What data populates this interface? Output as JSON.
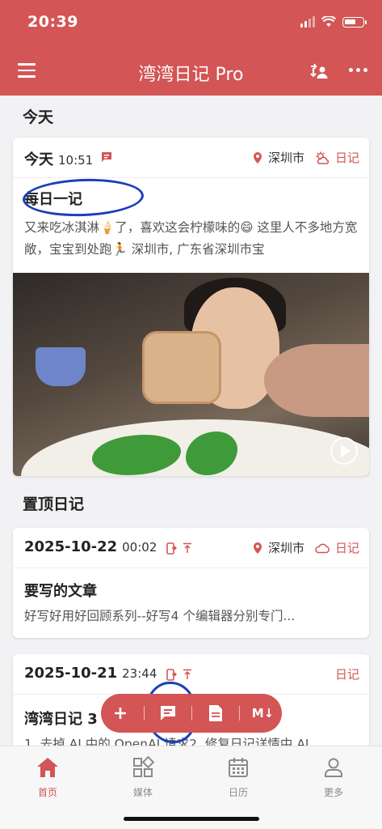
{
  "status": {
    "time": "20:39"
  },
  "app": {
    "title": "湾湾日记 Pro"
  },
  "sections": {
    "today": "今天",
    "pinned": "置顶日记"
  },
  "today_entry": {
    "date": "今天",
    "time": "10:51",
    "location": "深圳市",
    "tag": "日记",
    "title": "每日一记",
    "snippet": "又来吃冰淇淋🍦了，喜欢这会柠檬味的😄 这里人不多地方宽敞，宝宝到处跑🏃 深圳市, 广东省深圳市宝"
  },
  "pinned_entries": [
    {
      "date": "2025-10-22",
      "time": "00:02",
      "location": "深圳市",
      "tag": "日记",
      "title": "要写的文章",
      "snippet": "好写好用好回顾系列--好写4 个编辑器分别专门..."
    },
    {
      "date": "2025-10-21",
      "time": "23:44",
      "tag": "日记",
      "title": "湾湾日记 3",
      "snippet": "1. 去掉 AI 中的 OpenAI 请求2. 修复日记详情中 AI"
    }
  ],
  "fab": {
    "markdown_label": "M↓"
  },
  "tabs": [
    {
      "label": "首页",
      "icon": "home-icon"
    },
    {
      "label": "媒体",
      "icon": "media-grid-icon"
    },
    {
      "label": "日历",
      "icon": "calendar-icon"
    },
    {
      "label": "更多",
      "icon": "person-icon"
    }
  ],
  "colors": {
    "accent": "#d35555",
    "marker": "#1b3fb8"
  }
}
